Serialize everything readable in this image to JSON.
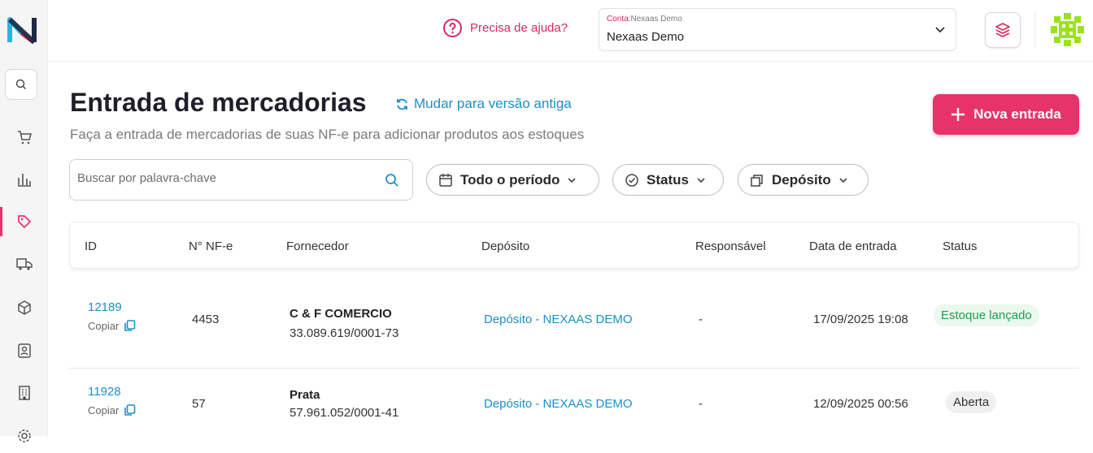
{
  "header": {
    "help_label": "Precisa de ajuda?",
    "account_label": "Conta:",
    "account_name_small": "Nexaas Demo",
    "account_value": "Nexaas Demo"
  },
  "page": {
    "title": "Entrada de mercadorias",
    "old_version_link": "Mudar para versão antiga",
    "subtitle": "Faça a entrada de mercadorias de suas NF-e para adicionar produtos aos estoques",
    "new_button": "Nova entrada"
  },
  "search": {
    "placeholder": "Buscar por palavra-chave"
  },
  "filters": {
    "period": "Todo o período",
    "status": "Status",
    "deposit": "Depósito"
  },
  "table": {
    "headers": [
      "ID",
      "N° NF-e",
      "Fornecedor",
      "Depósito",
      "Responsável",
      "Data de entrada",
      "Status"
    ],
    "copy_label": "Copiar",
    "rows": [
      {
        "id": "12189",
        "nfe": "4453",
        "supplier": "C & F COMERCIO",
        "cnpj": "33.089.619/0001-73",
        "deposit": "Depósito - NEXAAS DEMO",
        "responsible": "-",
        "date": "17/09/2025 19:08",
        "status": "Estoque lançado"
      },
      {
        "id": "11928",
        "nfe": "57",
        "supplier": "Prata",
        "cnpj": "57.961.052/0001-41",
        "deposit": "Depósito - NEXAAS DEMO",
        "responsible": "-",
        "date": "12/09/2025 00:56",
        "status": "Aberta"
      }
    ]
  },
  "colors": {
    "accent": "#e8336a",
    "link": "#1b8fc7",
    "success": "#1f9d4f"
  }
}
